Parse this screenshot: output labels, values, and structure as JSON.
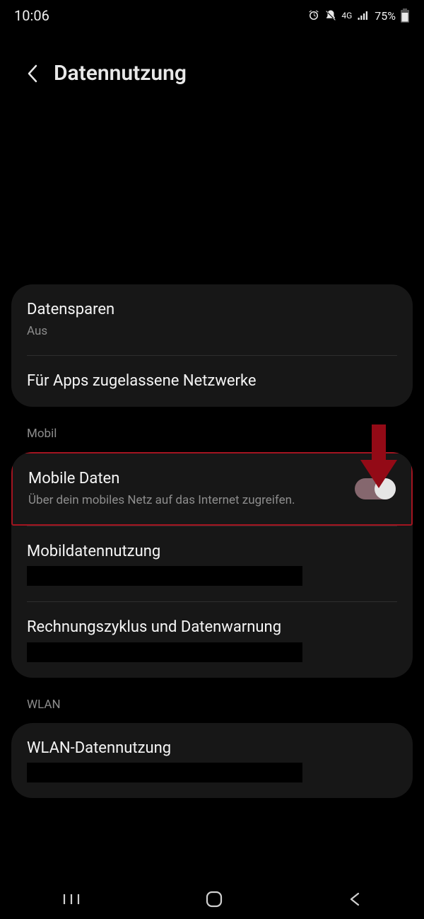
{
  "status": {
    "time": "10:06",
    "network_label": "4G",
    "battery_pct": "75%"
  },
  "header": {
    "title": "Datennutzung"
  },
  "card1": {
    "datensparen_title": "Datensparen",
    "datensparen_value": "Aus",
    "allowed_title": "Für Apps zugelassene Netzwerke"
  },
  "section_mobil": "Mobil",
  "card2": {
    "mobile_daten_title": "Mobile Daten",
    "mobile_daten_sub": "Über dein mobiles Netz auf das Internet zugreifen.",
    "mobildatennutzung_title": "Mobildatennutzung",
    "rechnung_title": "Rechnungszyklus und Datenwarnung"
  },
  "section_wlan": "WLAN",
  "card3": {
    "wlan_title": "WLAN-Datennutzung"
  }
}
